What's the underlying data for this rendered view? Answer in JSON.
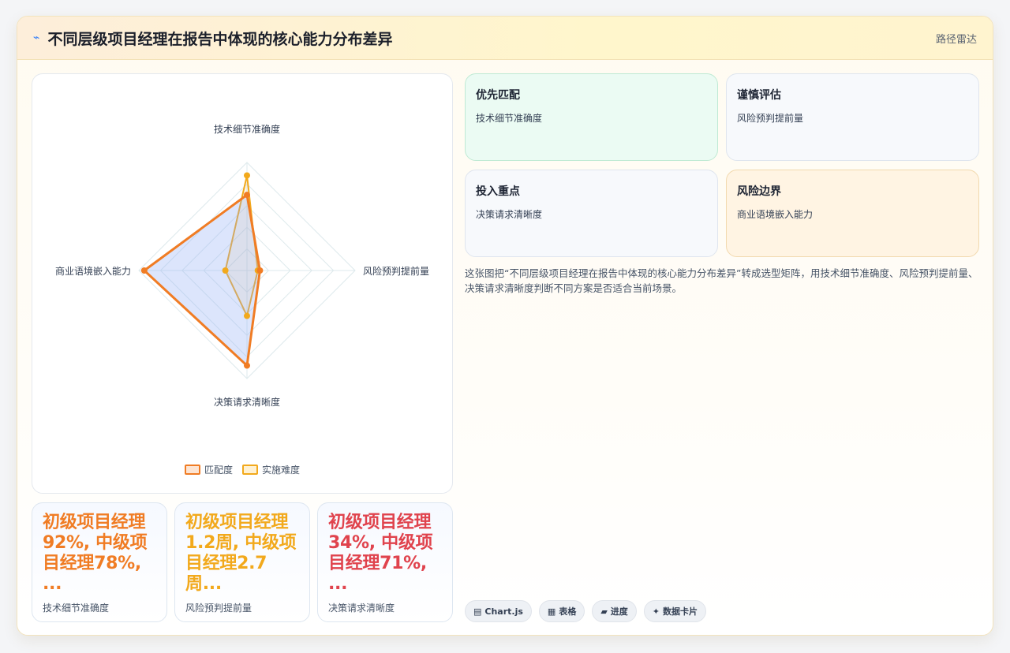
{
  "header": {
    "icon": "bolt-icon",
    "title": "不同层级项目经理在报告中体现的核心能力分布差异",
    "tag": "路径雷达"
  },
  "colors": {
    "match": "#f07c24",
    "difficulty": "#f2a91c",
    "danger": "#e0434d",
    "accent_blue": "#3b82f6"
  },
  "chart_data": {
    "type": "radar",
    "axes": [
      "技术细节准确度",
      "风险预判提前量",
      "决策请求清晰度",
      "商业语境嵌入能力"
    ],
    "range": [
      0,
      100
    ],
    "grid": true,
    "legend_position": "bottom",
    "series": [
      {
        "name": "匹配度",
        "values": [
          70,
          12,
          88,
          95
        ],
        "color": "#f07c24"
      },
      {
        "name": "实施难度",
        "values": [
          88,
          10,
          42,
          20
        ],
        "color": "#f2a91c"
      }
    ]
  },
  "stats": [
    {
      "value": "初级项目经理92%, 中级项目经理78%, ...",
      "label": "技术细节准确度",
      "color": "#f07c24"
    },
    {
      "value": "初级项目经理1.2周, 中级项目经理2.7周...",
      "label": "风险预判提前量",
      "color": "#f2a91c"
    },
    {
      "value": "初级项目经理34%, 中级项目经理71%, ...",
      "label": "决策请求清晰度",
      "color": "#e0434d"
    }
  ],
  "boxes": [
    {
      "title": "优先匹配",
      "text": "技术细节准确度"
    },
    {
      "title": "谨慎评估",
      "text": "风险预判提前量"
    },
    {
      "title": "投入重点",
      "text": "决策请求清晰度"
    },
    {
      "title": "风险边界",
      "text": "商业语境嵌入能力"
    }
  ],
  "description": "这张图把“不同层级项目经理在报告中体现的核心能力分布差异”转成选型矩阵，用技术细节准确度、风险预判提前量、决策请求清晰度判断不同方案是否适合当前场景。",
  "chips": [
    {
      "icon": "chart-icon",
      "glyph": "▤",
      "label": "Chart.js"
    },
    {
      "icon": "table-icon",
      "glyph": "▦",
      "label": "表格"
    },
    {
      "icon": "progress-icon",
      "glyph": "▰",
      "label": "进度"
    },
    {
      "icon": "sparkle-icon",
      "glyph": "✦",
      "label": "数据卡片"
    }
  ]
}
